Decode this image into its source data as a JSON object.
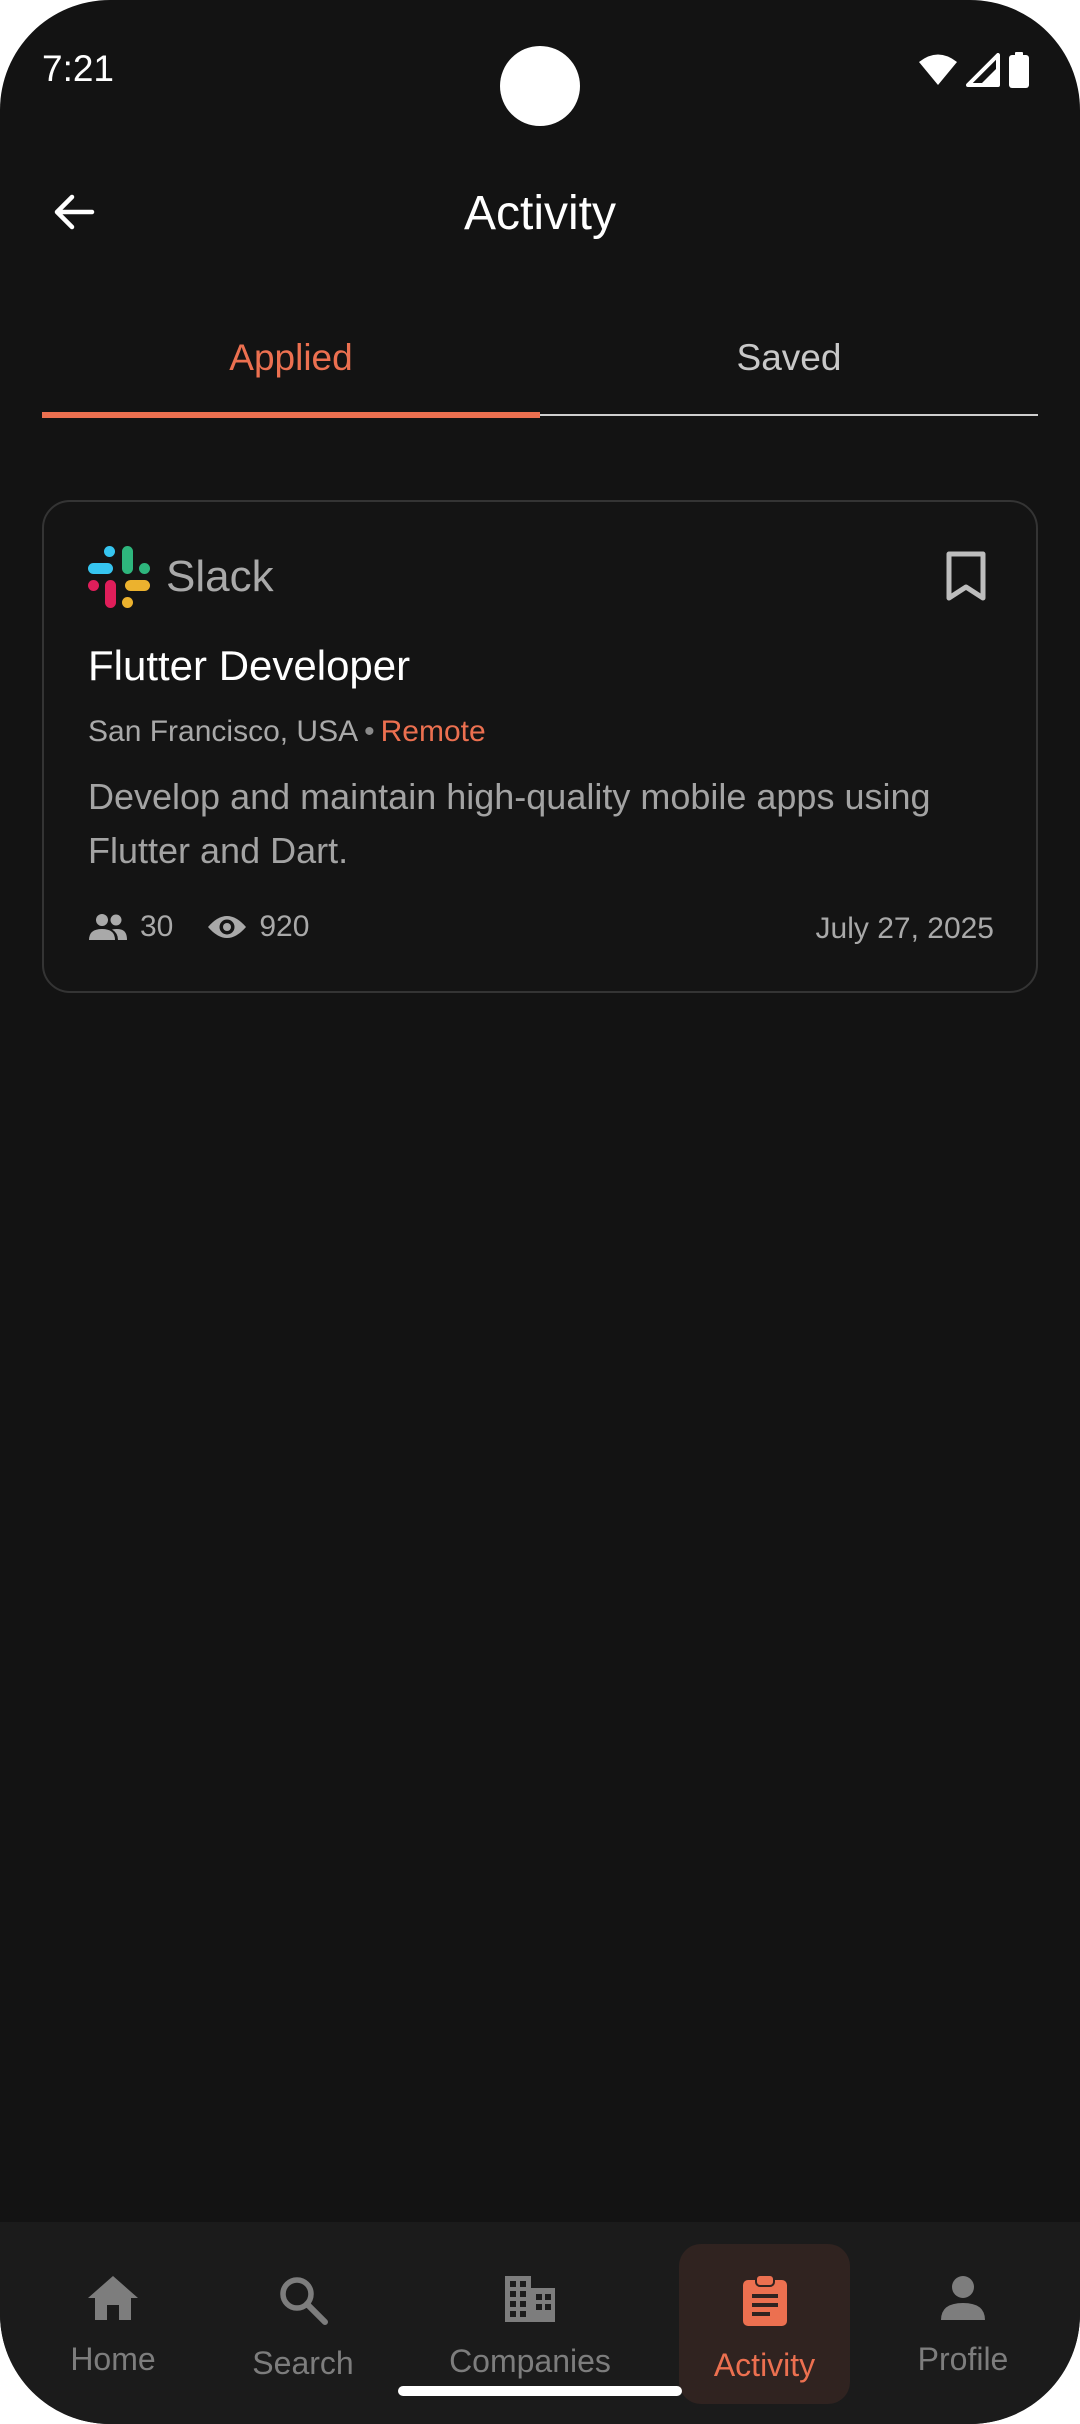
{
  "status_bar": {
    "time": "7:21",
    "icons": [
      "wifi-icon",
      "cell-signal-icon",
      "battery-icon"
    ]
  },
  "app_bar": {
    "title": "Activity",
    "back_icon": "arrow-back-icon"
  },
  "tabs": [
    {
      "label": "Applied",
      "selected": true
    },
    {
      "label": "Saved",
      "selected": false
    }
  ],
  "job_card": {
    "company": "Slack",
    "logo_icon": "slack-logo",
    "bookmark_icon": "bookmark-outline-icon",
    "title": "Flutter Developer",
    "location": "San Francisco, USA",
    "separator": "•",
    "work_mode": "Remote",
    "description": "Develop and maintain high-quality mobile apps using Flutter and Dart.",
    "applicants": "30",
    "views": "920",
    "date": "July 27, 2025"
  },
  "bottom_nav": {
    "items": [
      {
        "label": "Home",
        "icon": "home-icon",
        "active": false
      },
      {
        "label": "Search",
        "icon": "search-icon",
        "active": false
      },
      {
        "label": "Companies",
        "icon": "building-icon",
        "active": false
      },
      {
        "label": "Activity",
        "icon": "clipboard-icon",
        "active": true
      },
      {
        "label": "Profile",
        "icon": "person-icon",
        "active": false
      }
    ]
  },
  "colors": {
    "background": "#131313",
    "accent": "#ec7050",
    "card_border": "#343434",
    "muted_text": "#a9a9a9",
    "nav_background": "#1b1b1b"
  }
}
